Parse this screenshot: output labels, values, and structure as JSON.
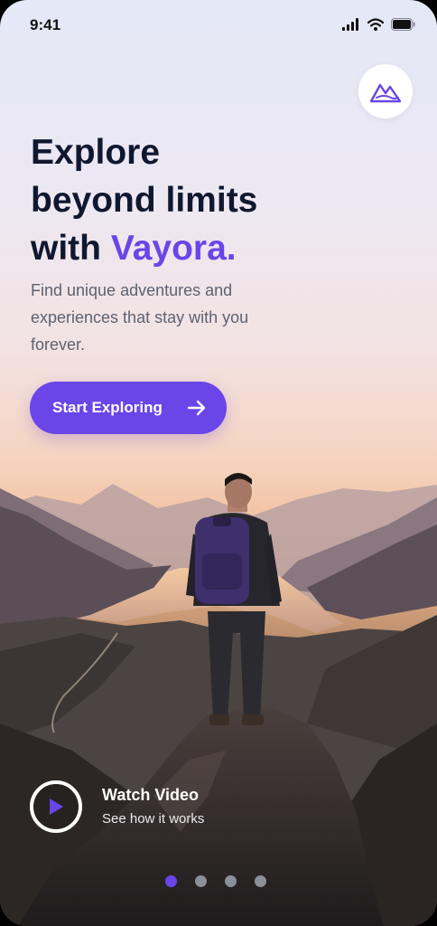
{
  "status_bar": {
    "time": "9:41",
    "icons": [
      "signal-icon",
      "wifi-icon",
      "battery-icon"
    ]
  },
  "brand": {
    "logo_icon": "mountain-logo-icon",
    "accent_color": "#6a45e8"
  },
  "hero": {
    "headline_line1": "Explore",
    "headline_line2": "beyond limits",
    "headline_line3_prefix": "with ",
    "headline_brand": "Vayora.",
    "subtitle": "Find unique adventures and experiences that stay with you forever."
  },
  "cta": {
    "label": "Start Exploring",
    "icon": "arrow-right-icon"
  },
  "video": {
    "title": "Watch Video",
    "subtitle": "See how it works",
    "icon": "play-icon"
  },
  "pagination": {
    "total": 4,
    "active": 1
  }
}
